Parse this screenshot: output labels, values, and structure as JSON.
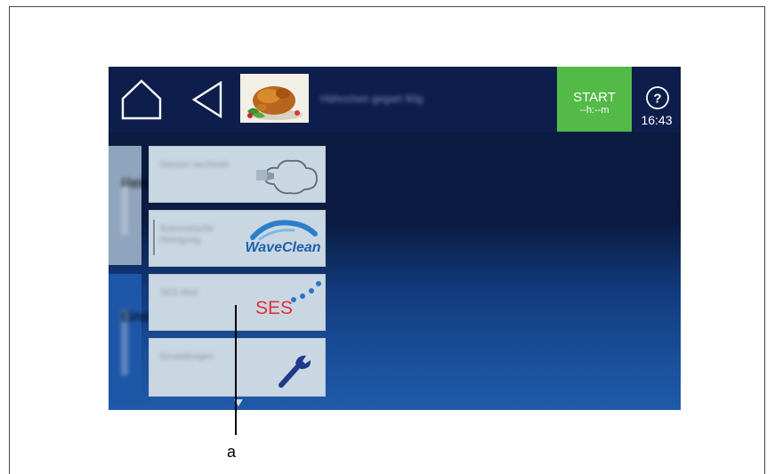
{
  "header": {
    "program_name": "Hähnchen gegart 90g",
    "start_label": "START",
    "start_timer": "--h:--m",
    "help_label": "?",
    "clock": "16:43"
  },
  "side_tabs": [
    {
      "label": "Reinigung"
    },
    {
      "label": "Einstellungen"
    }
  ],
  "tiles": [
    {
      "label": "Wasser wechseln",
      "icon": "steam-cloud-icon"
    },
    {
      "label": "Automatische Reinigung",
      "icon": "waveclean-logo",
      "logo_text": "WaveClean"
    },
    {
      "label": "SES Mod",
      "icon": "ses-logo",
      "logo_text": "SES"
    },
    {
      "label": "Einstellungen",
      "icon": "wrench-icon"
    }
  ],
  "callout": {
    "label": "a"
  },
  "colors": {
    "start_green": "#53b947",
    "screen_navy": "#0e1e4c",
    "tile_bg": "#c9d7e2",
    "ses_red": "#e23030"
  }
}
